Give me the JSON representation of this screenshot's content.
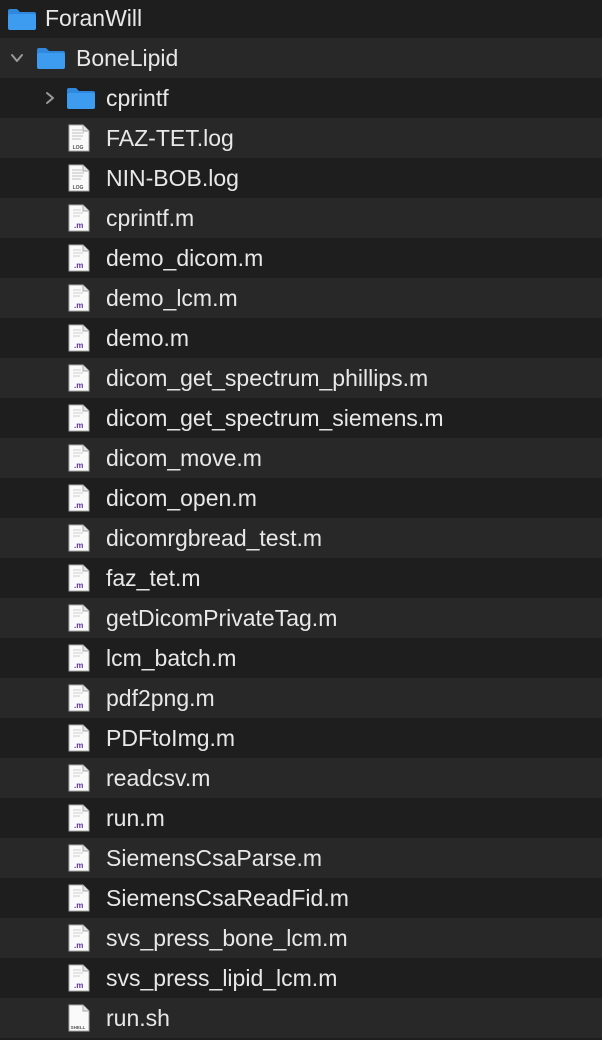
{
  "tree": {
    "root": {
      "label": "ForanWill",
      "icon": "folder-icon"
    },
    "parent": {
      "label": "BoneLipid",
      "icon": "folder-icon",
      "expanded": true
    },
    "items": [
      {
        "label": "cprintf",
        "icon": "folder-icon",
        "kind": "folder",
        "expandable": true,
        "expanded": false
      },
      {
        "label": "FAZ-TET.log",
        "icon": "log-file-icon",
        "kind": "log",
        "badge": "LOG"
      },
      {
        "label": "NIN-BOB.log",
        "icon": "log-file-icon",
        "kind": "log",
        "badge": "LOG"
      },
      {
        "label": "cprintf.m",
        "icon": "matlab-file-icon",
        "kind": "m",
        "badge": ".m"
      },
      {
        "label": "demo_dicom.m",
        "icon": "matlab-file-icon",
        "kind": "m",
        "badge": ".m"
      },
      {
        "label": "demo_lcm.m",
        "icon": "matlab-file-icon",
        "kind": "m",
        "badge": ".m"
      },
      {
        "label": "demo.m",
        "icon": "matlab-file-icon",
        "kind": "m",
        "badge": ".m"
      },
      {
        "label": "dicom_get_spectrum_phillips.m",
        "icon": "matlab-file-icon",
        "kind": "m",
        "badge": ".m"
      },
      {
        "label": "dicom_get_spectrum_siemens.m",
        "icon": "matlab-file-icon",
        "kind": "m",
        "badge": ".m"
      },
      {
        "label": "dicom_move.m",
        "icon": "matlab-file-icon",
        "kind": "m",
        "badge": ".m"
      },
      {
        "label": "dicom_open.m",
        "icon": "matlab-file-icon",
        "kind": "m",
        "badge": ".m"
      },
      {
        "label": "dicomrgbread_test.m",
        "icon": "matlab-file-icon",
        "kind": "m",
        "badge": ".m"
      },
      {
        "label": "faz_tet.m",
        "icon": "matlab-file-icon",
        "kind": "m",
        "badge": ".m"
      },
      {
        "label": "getDicomPrivateTag.m",
        "icon": "matlab-file-icon",
        "kind": "m",
        "badge": ".m"
      },
      {
        "label": "lcm_batch.m",
        "icon": "matlab-file-icon",
        "kind": "m",
        "badge": ".m"
      },
      {
        "label": "pdf2png.m",
        "icon": "matlab-file-icon",
        "kind": "m",
        "badge": ".m"
      },
      {
        "label": "PDFtoImg.m",
        "icon": "matlab-file-icon",
        "kind": "m",
        "badge": ".m"
      },
      {
        "label": "readcsv.m",
        "icon": "matlab-file-icon",
        "kind": "m",
        "badge": ".m"
      },
      {
        "label": "run.m",
        "icon": "matlab-file-icon",
        "kind": "m",
        "badge": ".m"
      },
      {
        "label": "SiemensCsaParse.m",
        "icon": "matlab-file-icon",
        "kind": "m",
        "badge": ".m"
      },
      {
        "label": "SiemensCsaReadFid.m",
        "icon": "matlab-file-icon",
        "kind": "m",
        "badge": ".m"
      },
      {
        "label": "svs_press_bone_lcm.m",
        "icon": "matlab-file-icon",
        "kind": "m",
        "badge": ".m"
      },
      {
        "label": "svs_press_lipid_lcm.m",
        "icon": "matlab-file-icon",
        "kind": "m",
        "badge": ".m"
      },
      {
        "label": "run.sh",
        "icon": "shell-file-icon",
        "kind": "sh",
        "badge": "SHELL"
      }
    ]
  },
  "colors": {
    "background": "#1e1e1e",
    "stripe": "#282828",
    "text": "#e8e8e8",
    "folder": "#3d9cf0",
    "folder_tab": "#2f88dc",
    "matlab_badge": "#5b2fa8",
    "disclosure": "#9a9a9a"
  }
}
